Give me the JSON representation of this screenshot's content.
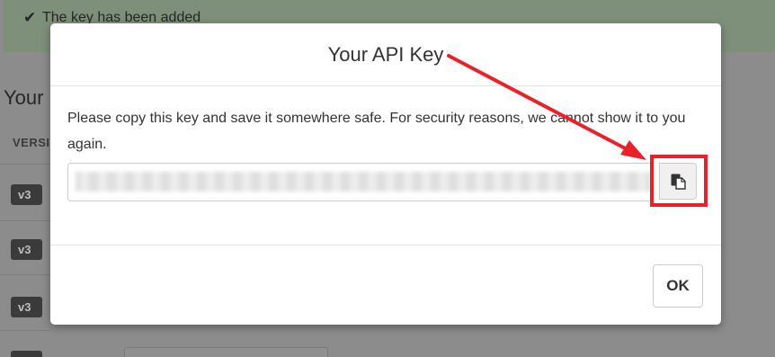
{
  "background": {
    "alert": {
      "text": "The key has been added",
      "icon": "check-icon"
    },
    "heading": "Your",
    "column_label": "VERSI",
    "badges": [
      "v3",
      "v3",
      "v3"
    ]
  },
  "modal": {
    "title": "Your API Key",
    "message": "Please copy this key and save it somewhere safe. For security reasons, we cannot show it to you again.",
    "copy_button_icon": "clipboard-copy-icon",
    "ok_label": "OK"
  },
  "annotation": {
    "arrow_color": "#e8212b",
    "box_color": "#e8212b"
  }
}
